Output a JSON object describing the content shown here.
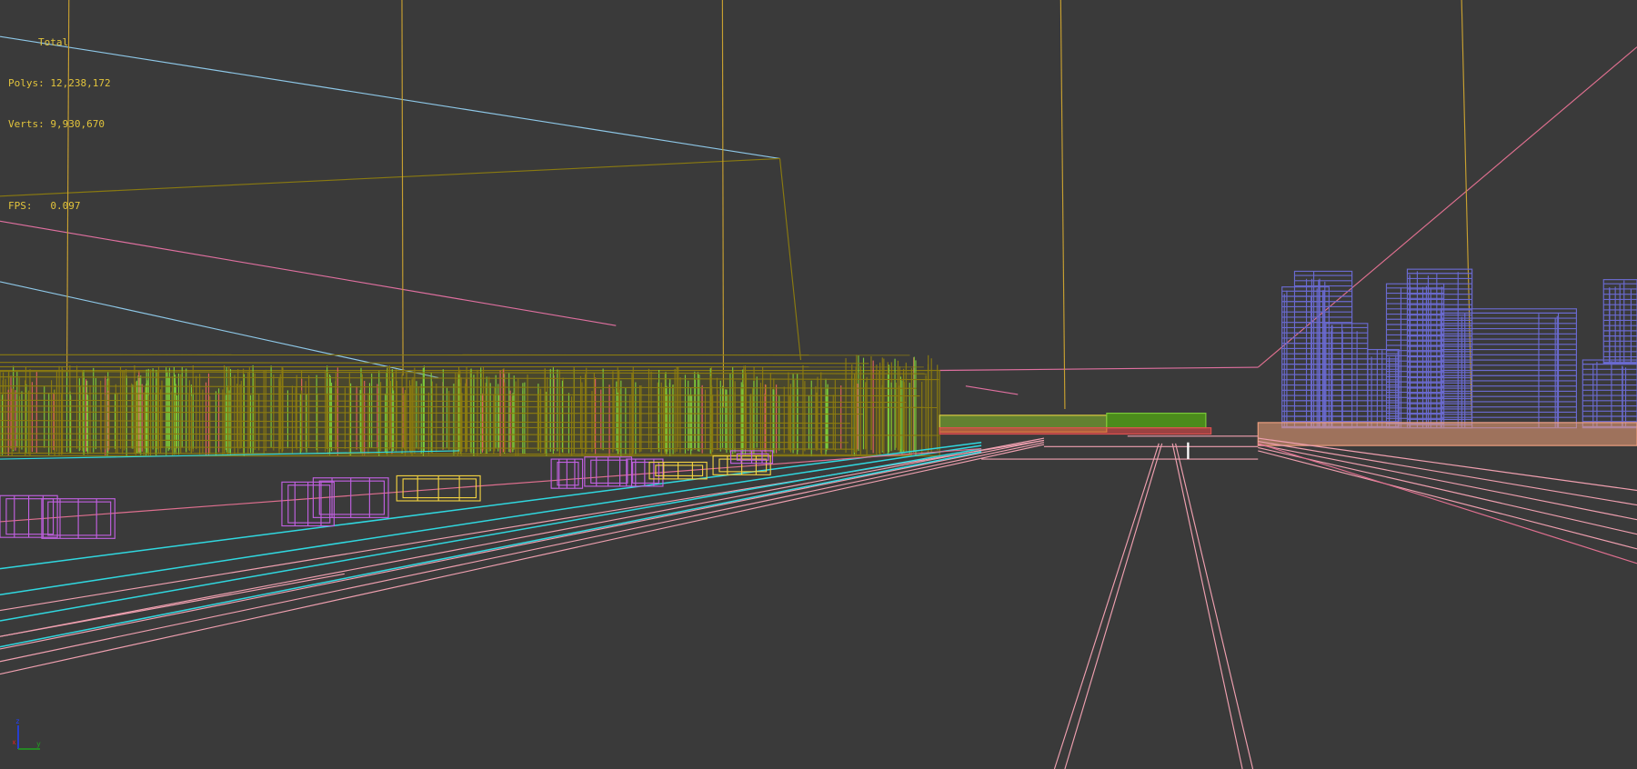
{
  "viewport": {
    "background": "#3a3a3a",
    "stats": {
      "title": "Total",
      "polys_label": "Polys:",
      "polys_value": "12,238,172",
      "verts_label": "Verts:",
      "verts_value": "9,930,670",
      "fps_label": "FPS:",
      "fps_value": "0.097"
    },
    "axis_gizmo": {
      "z": "z",
      "x": "x",
      "y": "y"
    },
    "colors": {
      "stats_text": "#e2c43c",
      "gold": "#c8a030",
      "olive": "#8a7a10",
      "green": "#7bc83a",
      "blue_buildings": "#6a6ad0",
      "pink": "#f0a0b0",
      "cyan": "#30d8e0",
      "magenta": "#c060e0",
      "light_blue": "#8ec8e8"
    }
  }
}
